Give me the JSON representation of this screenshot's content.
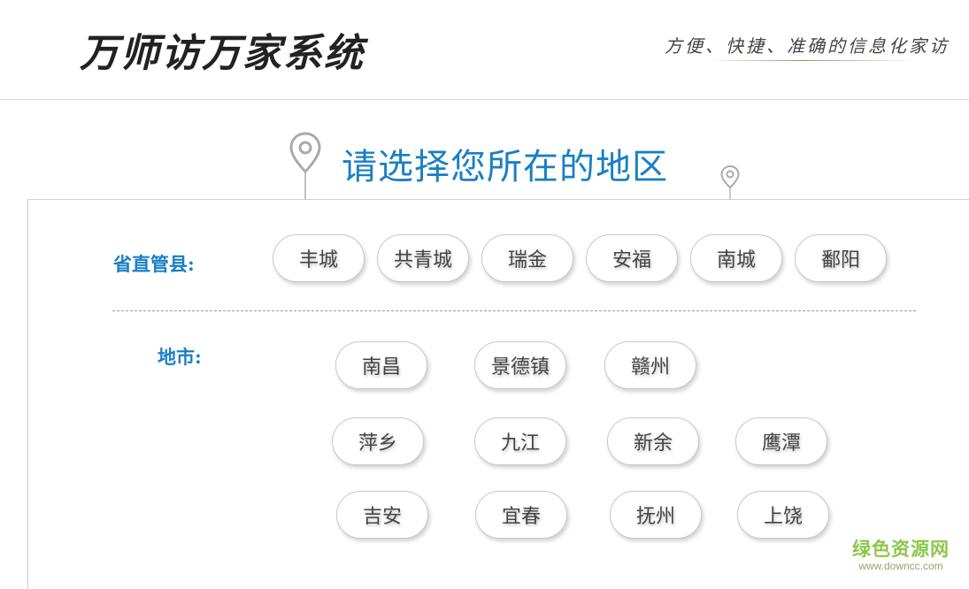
{
  "header": {
    "app_title": "万师访万家系统",
    "slogan": "方便、快捷、准确的信息化家访"
  },
  "main": {
    "title": "请选择您所在的地区",
    "counties_label": "省直管县:",
    "counties": [
      "丰城",
      "共青城",
      "瑞金",
      "安福",
      "南城",
      "鄱阳"
    ],
    "cities_label": "地市:",
    "cities": [
      "南昌",
      "景德镇",
      "赣州",
      "萍乡",
      "九江",
      "新余",
      "鹰潭",
      "吉安",
      "宜春",
      "抚州",
      "上饶"
    ]
  },
  "watermark": {
    "name": "绿色资源网",
    "url": "www.downcc.com"
  },
  "colors": {
    "accent": "#1a7fc4",
    "pill_border": "#c9c9c9",
    "watermark": "#8cc74a"
  },
  "icons": [
    "location-pin-icon"
  ]
}
